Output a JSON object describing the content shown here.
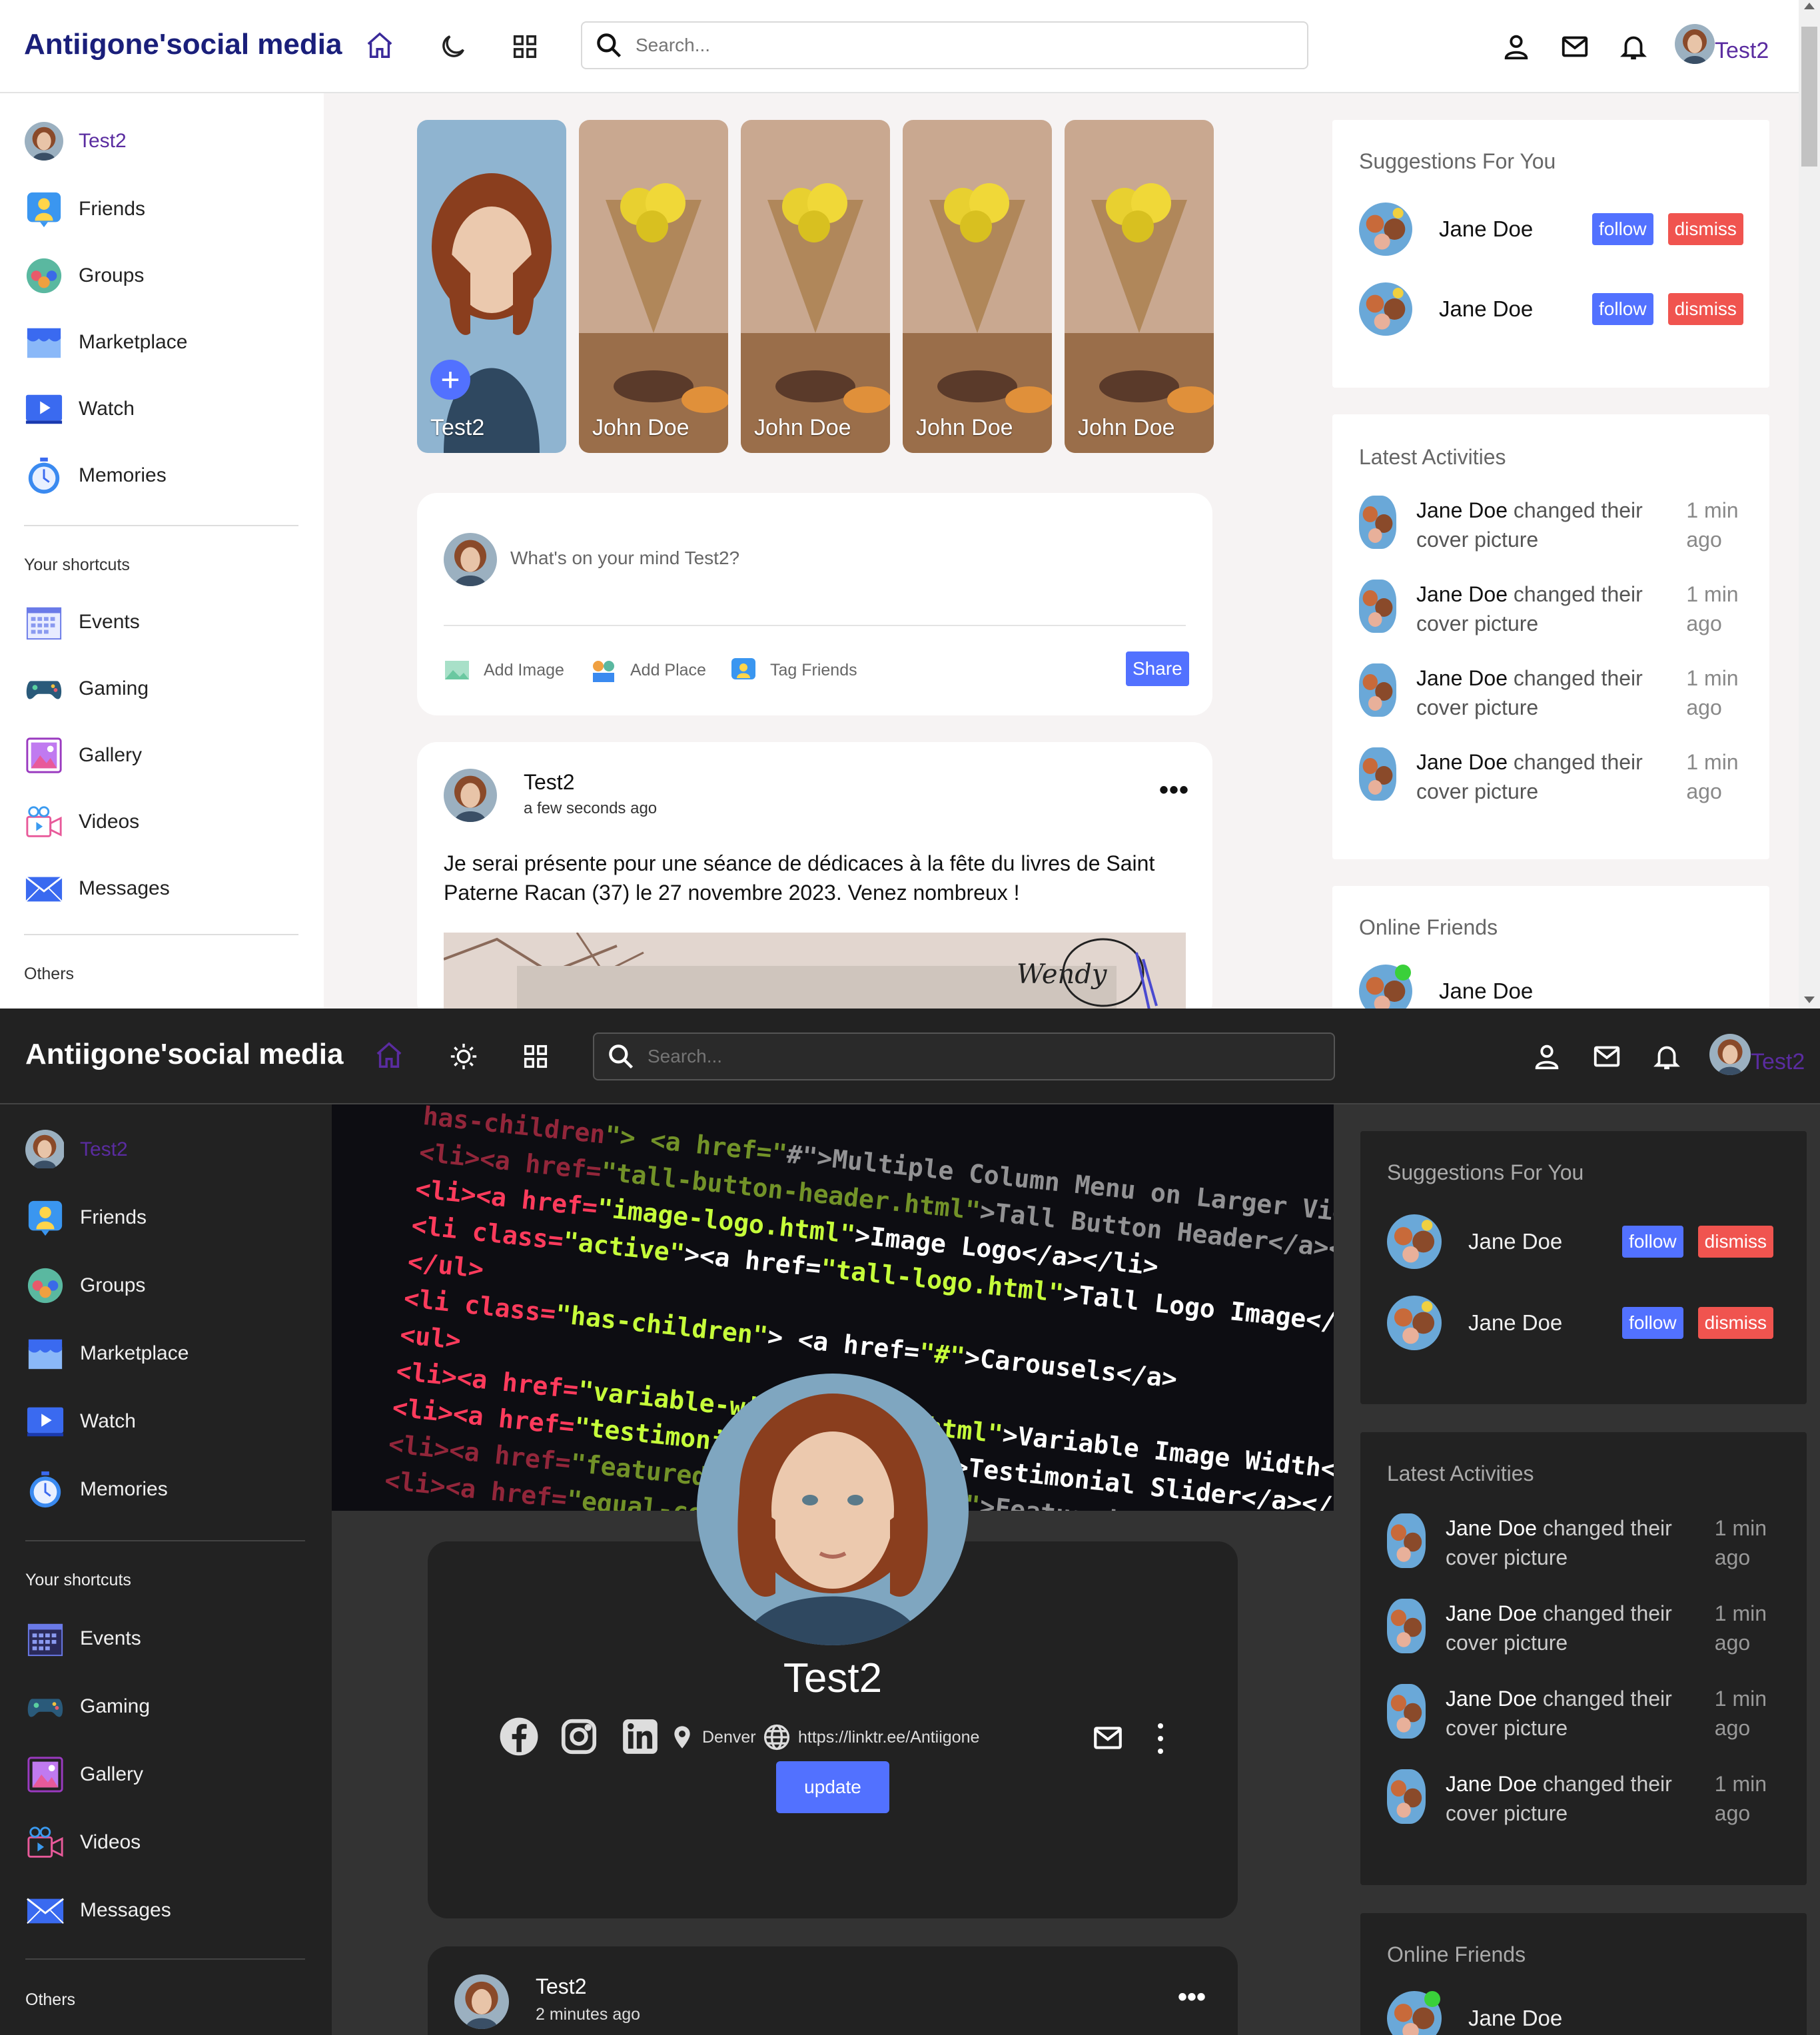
{
  "app": {
    "brand": "Antiigone'social media",
    "user_name": "Test2",
    "search_placeholder": "Search..."
  },
  "sidebar": {
    "user_label": "Test2",
    "menu": [
      {
        "label": "Friends",
        "icon": "friends-icon"
      },
      {
        "label": "Groups",
        "icon": "groups-icon"
      },
      {
        "label": "Marketplace",
        "icon": "marketplace-icon"
      },
      {
        "label": "Watch",
        "icon": "watch-icon"
      },
      {
        "label": "Memories",
        "icon": "memories-icon"
      }
    ],
    "shortcuts_heading": "Your shortcuts",
    "shortcuts": [
      {
        "label": "Events",
        "icon": "events-icon"
      },
      {
        "label": "Gaming",
        "icon": "gaming-icon"
      },
      {
        "label": "Gallery",
        "icon": "gallery-icon"
      },
      {
        "label": "Videos",
        "icon": "videos-icon"
      },
      {
        "label": "Messages",
        "icon": "messages-icon"
      }
    ],
    "others_heading": "Others"
  },
  "stories": [
    {
      "name": "Test2",
      "own": true
    },
    {
      "name": "John Doe"
    },
    {
      "name": "John Doe"
    },
    {
      "name": "John Doe"
    },
    {
      "name": "John Doe"
    }
  ],
  "composer": {
    "placeholder": "What's on your mind Test2?",
    "add_image": "Add Image",
    "add_place": "Add Place",
    "tag_friends": "Tag Friends",
    "share": "Share"
  },
  "post_light": {
    "author": "Test2",
    "time": "a few seconds ago",
    "text": "Je serai présente pour une séance de dédicaces à la fête du livres de Saint Paterne Racan (37) le 27 novembre 2023. Venez nombreux !"
  },
  "rightbar": {
    "suggestions_title": "Suggestions For You",
    "suggestions": [
      {
        "name": "Jane Doe"
      },
      {
        "name": "Jane Doe"
      }
    ],
    "follow_label": "follow",
    "dismiss_label": "dismiss",
    "activities_title": "Latest Activities",
    "activities": [
      {
        "name": "Jane Doe",
        "action": "changed their cover picture",
        "time": "1 min ago"
      },
      {
        "name": "Jane Doe",
        "action": "changed their cover picture",
        "time": "1 min ago"
      },
      {
        "name": "Jane Doe",
        "action": "changed their cover picture",
        "time": "1 min ago"
      },
      {
        "name": "Jane Doe",
        "action": "changed their cover picture",
        "time": "1 min ago"
      }
    ],
    "online_title": "Online Friends",
    "online": [
      {
        "name": "Jane Doe"
      }
    ]
  },
  "profile": {
    "name": "Test2",
    "city": "Denver",
    "website": "https://linktr.ee/Antiigone",
    "update_label": "update",
    "cover_code_lines": [
      "has-children\"> <a href=\"#\">Multiple Column Menu on Larger Viewports",
      "<li><a href=\"tall-button-header.html\">Tall Button Header</a></li>",
      "<li><a href=\"image-logo.html\">Image Logo</a></li>",
      "<li class=\"active\"><a href=\"tall-logo.html\">Tall Logo Image</a></li>",
      "</ul>",
      "<li class=\"has-children\"> <a href=\"#\">Carousels</a>",
      "<ul>",
      "<li><a href=\"variable-width-slider.html\">Variable Image Width</a></li>",
      "<li><a href=\"testimonial-slider.html\">Testimonial Slider</a></li>",
      "<li><a href=\"featured-work-slider.html\">Featured Work Slider</a></li>",
      "<li><a href=\"equal-column-slider.html\">Equal Column Slider</a></li>"
    ]
  },
  "post_dark": {
    "author": "Test2",
    "time": "2 minutes ago"
  },
  "colors": {
    "accent": "#5271ff",
    "danger": "#f0544f",
    "brand_light": "#1a1f7a",
    "home_active": "#5a2ca0"
  }
}
